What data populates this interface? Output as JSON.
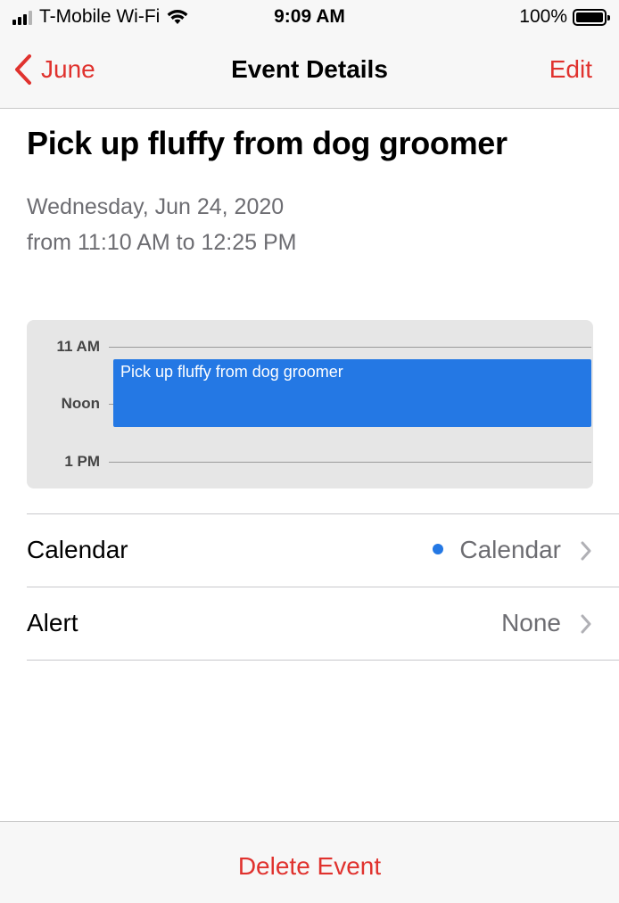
{
  "status_bar": {
    "carrier": "T-Mobile Wi-Fi",
    "time": "9:09 AM",
    "battery_percent": "100%",
    "battery_level": 1.0,
    "signal_bars_filled": 3,
    "signal_bars_total": 4
  },
  "nav": {
    "back_label": "June",
    "title": "Event Details",
    "edit_label": "Edit",
    "back_icon": "chevron-left-icon"
  },
  "event": {
    "title": "Pick up fluffy from dog groomer",
    "date": "Wednesday, Jun 24, 2020",
    "time_range": "from 11:10 AM to 12:25 PM"
  },
  "day_view": {
    "hours": [
      "11 AM",
      "Noon",
      "1 PM"
    ],
    "event_label": "Pick up fluffy from dog groomer",
    "event_color": "#2478e4"
  },
  "rows": {
    "calendar": {
      "label": "Calendar",
      "value": "Calendar",
      "dot_color": "#2478e4"
    },
    "alert": {
      "label": "Alert",
      "value": "None"
    }
  },
  "toolbar": {
    "delete_label": "Delete Event"
  },
  "colors": {
    "accent": "#e0322e",
    "secondary_text": "#6d6d72",
    "bar_background": "#f7f7f7"
  }
}
